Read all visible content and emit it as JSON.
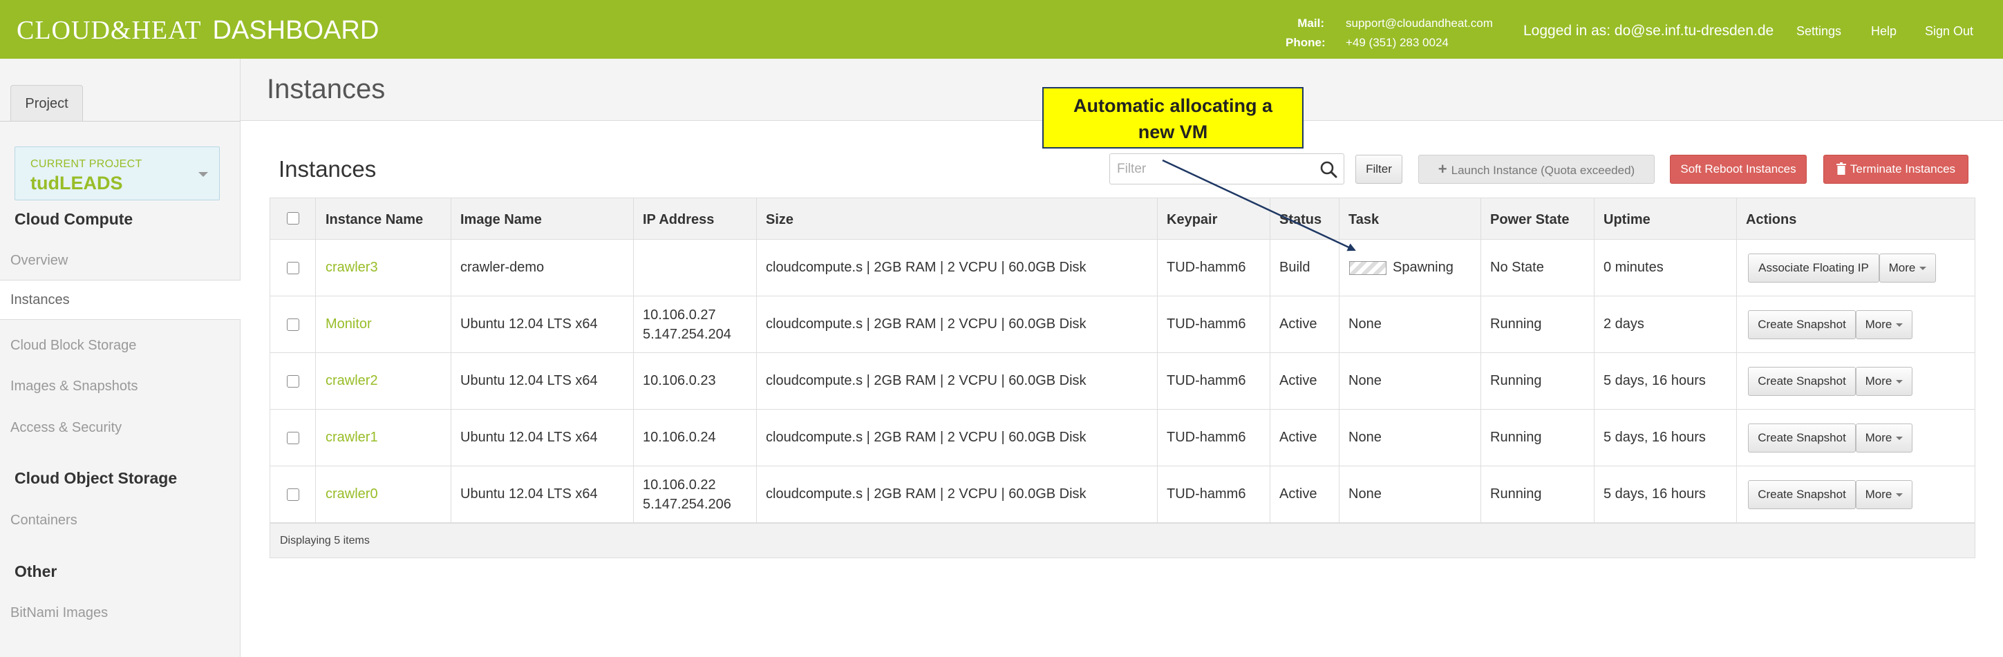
{
  "topbar": {
    "brand": "CLOUD&HEAT",
    "brand_suffix": "DASHBOARD",
    "mail_label": "Mail:",
    "mail_value": "support@cloudandheat.com",
    "phone_label": "Phone:",
    "phone_value": "+49 (351) 283 0024",
    "logged_in": "Logged in as: do@se.inf.tu-dresden.de",
    "links": [
      "Settings",
      "Help",
      "Sign Out"
    ],
    "bg_color": "#98bd27"
  },
  "page_title": "Instances",
  "sidebar": {
    "tab": "Project",
    "current_project_label": "CURRENT PROJECT",
    "current_project": "tudLEADS",
    "sections": [
      {
        "title": "Cloud Compute",
        "items": [
          "Overview",
          "Instances",
          "Cloud Block Storage",
          "Images & Snapshots",
          "Access & Security"
        ]
      },
      {
        "title": "Cloud Object Storage",
        "items": [
          "Containers"
        ]
      },
      {
        "title": "Other",
        "items": [
          "BitNami Images"
        ]
      }
    ],
    "active_item": "Instances"
  },
  "main": {
    "title": "Instances",
    "filter_placeholder": "Filter",
    "filter_button": "Filter",
    "launch_button": "Launch Instance (Quota exceeded)",
    "soft_reboot_button": "Soft Reboot Instances",
    "terminate_button": "Terminate Instances"
  },
  "table": {
    "columns": [
      "Instance Name",
      "Image Name",
      "IP Address",
      "Size",
      "Keypair",
      "Status",
      "Task",
      "Power State",
      "Uptime",
      "Actions"
    ],
    "rows": [
      {
        "name": "crawler3",
        "image": "crawler-demo",
        "ip1": "",
        "ip2": "",
        "size": "cloudcompute.s | 2GB RAM | 2 VCPU | 60.0GB Disk",
        "keypair": "TUD-hamm6",
        "status": "Build",
        "task": "Spawning",
        "power": "No State",
        "uptime": "0 minutes",
        "action": "Associate Floating IP",
        "more": "More"
      },
      {
        "name": "Monitor",
        "image": "Ubuntu 12.04 LTS x64",
        "ip1": "10.106.0.27",
        "ip2": "5.147.254.204",
        "size": "cloudcompute.s | 2GB RAM | 2 VCPU | 60.0GB Disk",
        "keypair": "TUD-hamm6",
        "status": "Active",
        "task": "None",
        "power": "Running",
        "uptime": "2 days",
        "action": "Create Snapshot",
        "more": "More"
      },
      {
        "name": "crawler2",
        "image": "Ubuntu 12.04 LTS x64",
        "ip1": "10.106.0.23",
        "ip2": "",
        "size": "cloudcompute.s | 2GB RAM | 2 VCPU | 60.0GB Disk",
        "keypair": "TUD-hamm6",
        "status": "Active",
        "task": "None",
        "power": "Running",
        "uptime": "5 days, 16 hours",
        "action": "Create Snapshot",
        "more": "More"
      },
      {
        "name": "crawler1",
        "image": "Ubuntu 12.04 LTS x64",
        "ip1": "10.106.0.24",
        "ip2": "",
        "size": "cloudcompute.s | 2GB RAM | 2 VCPU | 60.0GB Disk",
        "keypair": "TUD-hamm6",
        "status": "Active",
        "task": "None",
        "power": "Running",
        "uptime": "5 days, 16 hours",
        "action": "Create Snapshot",
        "more": "More"
      },
      {
        "name": "crawler0",
        "image": "Ubuntu 12.04 LTS x64",
        "ip1": "10.106.0.22",
        "ip2": "5.147.254.206",
        "size": "cloudcompute.s | 2GB RAM | 2 VCPU | 60.0GB Disk",
        "keypair": "TUD-hamm6",
        "status": "Active",
        "task": "None",
        "power": "Running",
        "uptime": "5 days, 16 hours",
        "action": "Create Snapshot",
        "more": "More"
      }
    ],
    "footer": "Displaying 5 items"
  },
  "callout": {
    "line1": "Automatic allocating a",
    "line2": "new VM"
  }
}
